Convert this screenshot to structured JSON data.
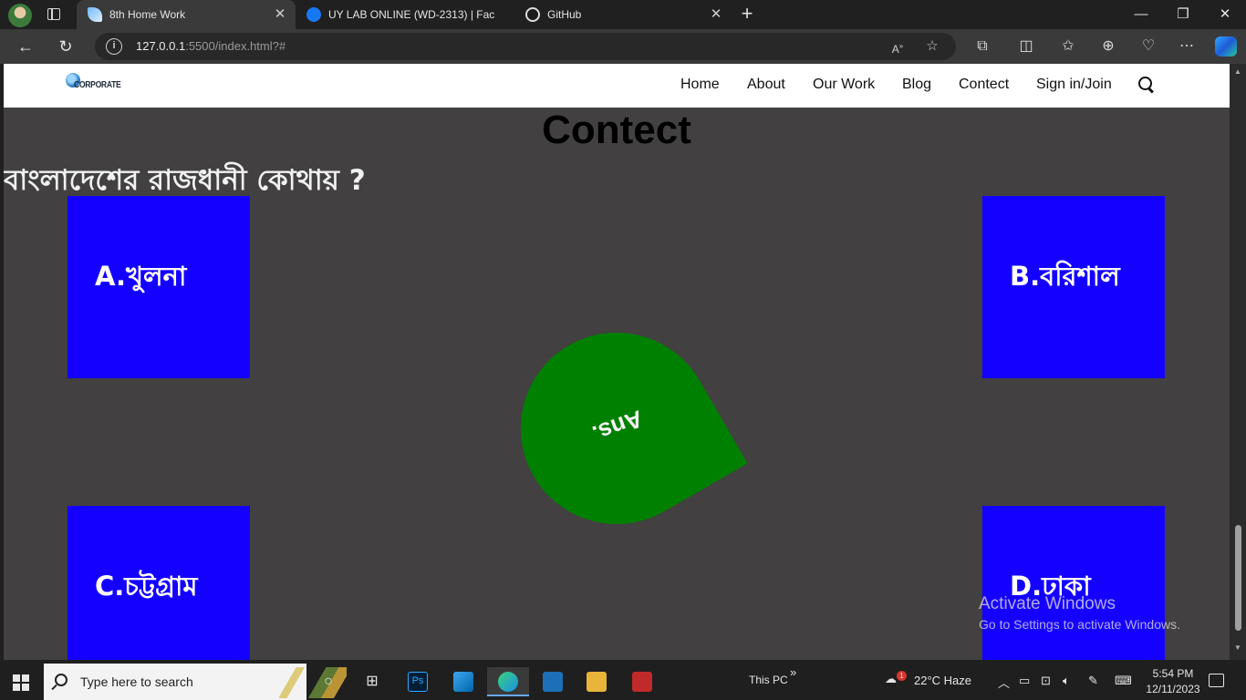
{
  "browser": {
    "tabs": [
      {
        "title": "8th Home Work",
        "active": true
      },
      {
        "title": "UY LAB ONLINE (WD-2313) | Fac",
        "active": false
      },
      {
        "title": "GitHub",
        "active": false
      }
    ],
    "url_host": "127.0.0.1",
    "url_rest": ":5500/index.html?#"
  },
  "site": {
    "logo_text": "CORPORATE",
    "nav": [
      "Home",
      "About",
      "Our Work",
      "Blog",
      "Contect",
      "Sign in/Join"
    ],
    "heading": "Contect",
    "question": "বাংলাদেশের রাজধানী কোথায় ?",
    "options": {
      "a": "A.খুলনা",
      "b": "B.বরিশাল",
      "c": "C.চট্টগ্রাম",
      "d": "D.ঢাকা"
    },
    "answer_label": "Ans.",
    "colors": {
      "option_bg": "#1400ff",
      "answer_bg": "#008000",
      "page_bg": "#424040"
    }
  },
  "watermark": {
    "line1": "Activate Windows",
    "line2": "Go to Settings to activate Windows."
  },
  "taskbar": {
    "search_placeholder": "Type here to search",
    "this_pc": "This PC",
    "weather": "22°C  Haze",
    "weather_badge": "1",
    "time": "5:54 PM",
    "date": "12/11/2023"
  }
}
